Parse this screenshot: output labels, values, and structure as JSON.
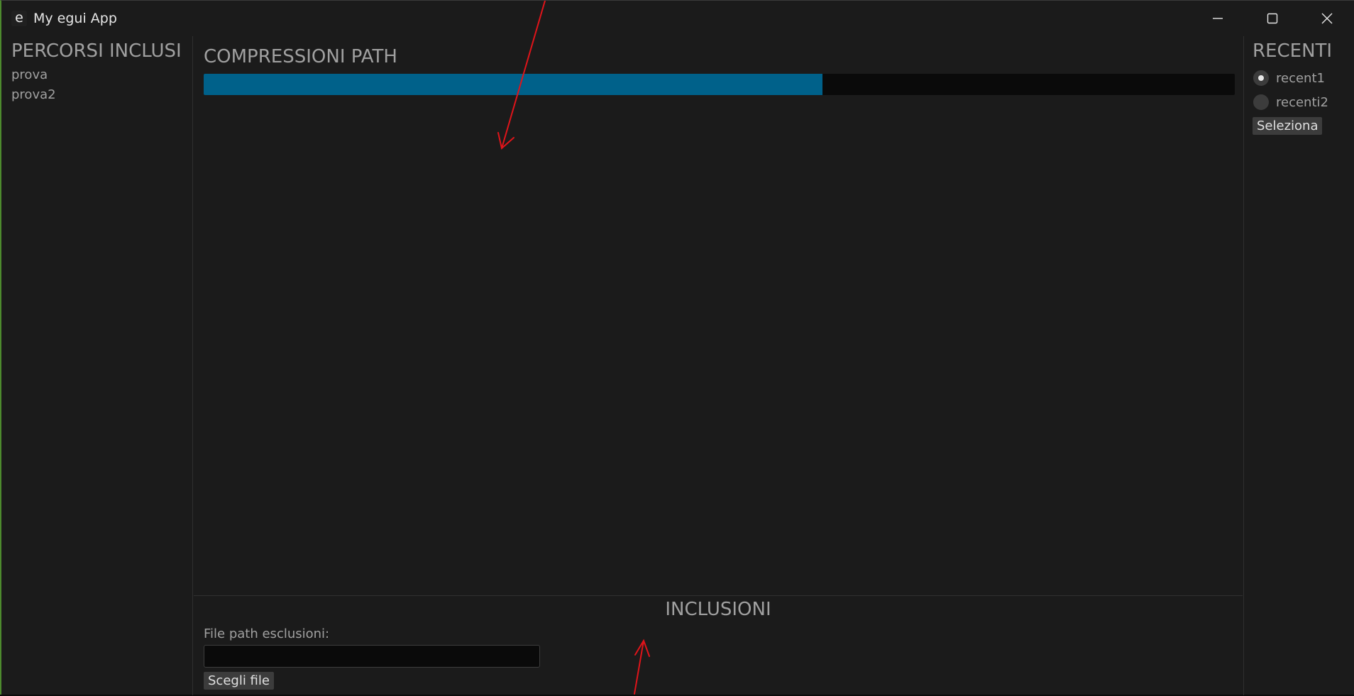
{
  "window": {
    "title": "My egui App",
    "icon": "egui-e-icon"
  },
  "titlebar_buttons": {
    "minimize": "minimize-icon",
    "maximize": "maximize-icon",
    "close": "close-icon"
  },
  "left_panel": {
    "heading": "PERCORSI INCLUSI",
    "items": [
      "prova",
      "prova2"
    ]
  },
  "center_panel": {
    "heading": "COMPRESSIONI PATH",
    "progress": 0.6
  },
  "right_panel": {
    "heading": "RECENTI",
    "options": [
      {
        "label": "recent1",
        "selected": true
      },
      {
        "label": "recenti2",
        "selected": false
      }
    ],
    "select_button": "Seleziona"
  },
  "bottom_panel": {
    "heading": "INCLUSIONI",
    "field_label": "File path esclusioni:",
    "field_value": "",
    "choose_button": "Scegli file"
  },
  "colors": {
    "accent": "#00618a",
    "annotation": "#e0141a",
    "frame": "#4d8a2e"
  }
}
